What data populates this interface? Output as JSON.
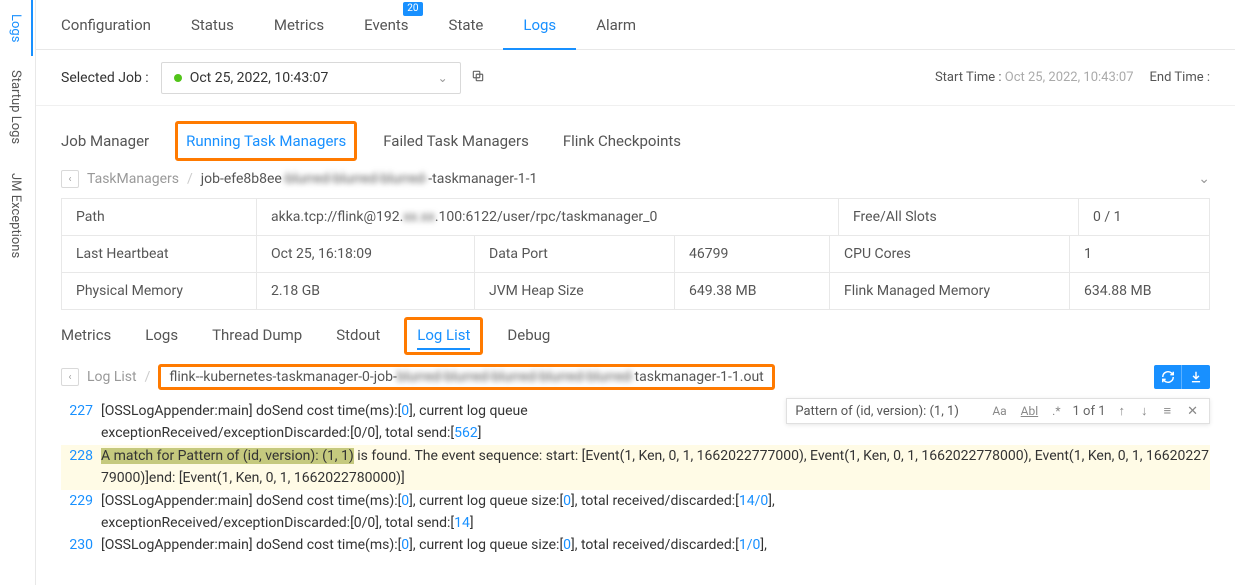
{
  "side_tabs": {
    "logs": "Logs",
    "startup": "Startup Logs",
    "jm": "JM Exceptions",
    "active": "Logs"
  },
  "top_tabs": {
    "items": [
      "Configuration",
      "Status",
      "Metrics",
      "Events",
      "State",
      "Logs",
      "Alarm"
    ],
    "active": "Logs",
    "events_badge": "20"
  },
  "selected_job": {
    "label": "Selected Job :",
    "value": "Oct 25, 2022, 10:43:07",
    "start_label": "Start Time :",
    "start_value": "Oct 25, 2022, 10:43:07",
    "end_label": "End Time :",
    "end_value": ""
  },
  "sub_tabs": {
    "items": [
      "Job Manager",
      "Running Task Managers",
      "Failed Task Managers",
      "Flink Checkpoints"
    ],
    "active": "Running Task Managers"
  },
  "breadcrumb": {
    "root": "TaskManagers",
    "current_prefix": "job-efe8b8ee",
    "current_blurred": "-blurred-blurred-blurred-",
    "current_suffix": "-taskmanager-1-1"
  },
  "info": {
    "path_label": "Path",
    "path_value_pre": "akka.tcp://flink@192.",
    "path_value_post": ".100:6122/user/rpc/taskmanager_0",
    "slots_label": "Free/All Slots",
    "slots_value": "0 / 1",
    "heartbeat_label": "Last Heartbeat",
    "heartbeat_value": "Oct 25, 16:18:09",
    "dataport_label": "Data Port",
    "dataport_value": "46799",
    "cores_label": "CPU Cores",
    "cores_value": "1",
    "physmem_label": "Physical Memory",
    "physmem_value": "2.18 GB",
    "heap_label": "JVM Heap Size",
    "heap_value": "649.38 MB",
    "managed_label": "Flink Managed Memory",
    "managed_value": "634.88 MB"
  },
  "log_tabs": {
    "items": [
      "Metrics",
      "Logs",
      "Thread Dump",
      "Stdout",
      "Log List",
      "Debug"
    ],
    "active": "Log List"
  },
  "log_breadcrumb": {
    "root": "Log List",
    "file_prefix": "flink--kubernetes-taskmanager-0-job-",
    "file_suffix": "taskmanager-1-1.out"
  },
  "search": {
    "value": "Pattern of (id, version): (1, 1)",
    "count": "1 of 1"
  },
  "log_lines": [
    {
      "n": "227",
      "pre": "[OSSLogAppender:main] doSend cost time(ms):[",
      "a": "0",
      "mid": "], current log queue\nexceptionReceived/exceptionDiscarded:[0/0], total send:[",
      "b": "562",
      "post": "]"
    },
    {
      "n": "228",
      "highlight": true,
      "match": "A match for Pattern of (id, version): (1, 1)",
      "rest": " is found. The event sequence: start: [Event(1, Ken, 0, 1, 1662022777000), Event(1, Ken, 0, 1, 1662022778000), Event(1, Ken, 0, 1, 1662022779000)]end: [Event(1, Ken, 0, 1, 1662022780000)]"
    },
    {
      "n": "229",
      "pre": "[OSSLogAppender:main] doSend cost time(ms):[",
      "a": "0",
      "mid1": "], current log queue size:[",
      "b": "0",
      "mid2": "], total received/discarded:[",
      "c": "14/0",
      "mid3": "],\nexceptionReceived/exceptionDiscarded:[0/0], total send:[",
      "d": "14",
      "post": "]"
    },
    {
      "n": "230",
      "pre": "[OSSLogAppender:main] doSend cost time(ms):[",
      "a": "0",
      "mid1": "], current log queue size:[",
      "b": "0",
      "mid2": "], total received/discarded:[",
      "c": "1/0",
      "post": "],"
    }
  ]
}
